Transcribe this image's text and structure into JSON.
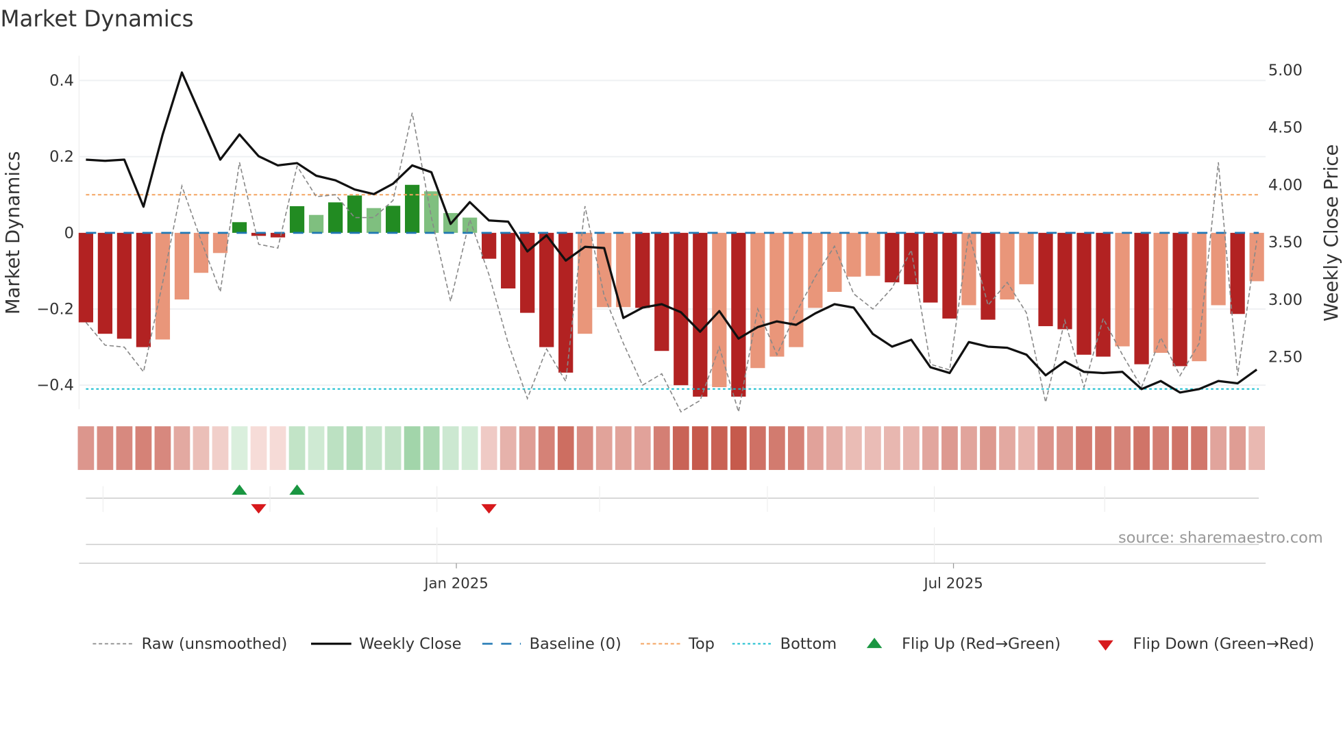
{
  "chart_data": {
    "type": "bar",
    "title": "Market Dynamics",
    "ylabel_left": "Market Dynamics",
    "ylabel_right": "Weekly Close Price",
    "ylim_left": [
      -0.47,
      0.47
    ],
    "ylim_right": [
      2.15,
      5.1
    ],
    "yticks_left": [
      {
        "v": 0.4,
        "label": "0.4"
      },
      {
        "v": 0.2,
        "label": "0.2"
      },
      {
        "v": 0,
        "label": "0"
      },
      {
        "v": -0.2,
        "label": "−0.2"
      },
      {
        "v": -0.4,
        "label": "−0.4"
      }
    ],
    "yticks_right": [
      {
        "v": 5.0,
        "label": "5.00"
      },
      {
        "v": 4.5,
        "label": "4.50"
      },
      {
        "v": 4.0,
        "label": "4.00"
      },
      {
        "v": 3.5,
        "label": "3.50"
      },
      {
        "v": 3.0,
        "label": "3.00"
      },
      {
        "v": 2.5,
        "label": "2.50"
      }
    ],
    "xticks": [
      {
        "index": 19.3,
        "label": "Jan 2025"
      },
      {
        "index": 45.2,
        "label": "Jul 2025"
      }
    ],
    "top_level": 0.1,
    "bottom_level": -0.41,
    "baseline": 0,
    "bars": [
      -0.235,
      -0.265,
      -0.278,
      -0.3,
      -0.28,
      -0.175,
      -0.105,
      -0.053,
      0.028,
      -0.008,
      -0.012,
      0.07,
      0.047,
      0.08,
      0.098,
      0.065,
      0.071,
      0.126,
      0.109,
      0.052,
      0.04,
      -0.068,
      -0.146,
      -0.21,
      -0.3,
      -0.367,
      -0.265,
      -0.195,
      -0.195,
      -0.197,
      -0.31,
      -0.4,
      -0.43,
      -0.405,
      -0.43,
      -0.355,
      -0.325,
      -0.3,
      -0.197,
      -0.155,
      -0.115,
      -0.113,
      -0.13,
      -0.135,
      -0.183,
      -0.225,
      -0.19,
      -0.228,
      -0.175,
      -0.135,
      -0.245,
      -0.253,
      -0.32,
      -0.325,
      -0.298,
      -0.345,
      -0.315,
      -0.35,
      -0.337,
      -0.19,
      -0.213,
      -0.127
    ],
    "bar_strong": [
      1,
      1,
      1,
      1,
      0,
      0,
      0,
      0,
      1,
      1,
      1,
      1,
      0,
      1,
      1,
      0,
      1,
      1,
      0,
      0,
      0,
      1,
      1,
      1,
      1,
      1,
      0,
      0,
      0,
      1,
      1,
      1,
      1,
      0,
      1,
      0,
      0,
      0,
      0,
      0,
      0,
      0,
      1,
      1,
      1,
      1,
      0,
      1,
      0,
      0,
      1,
      1,
      1,
      1,
      0,
      1,
      0,
      1,
      0,
      0,
      1,
      0
    ],
    "weekly_close": [
      4.22,
      4.21,
      4.22,
      3.81,
      4.44,
      4.98,
      4.6,
      4.22,
      4.44,
      4.25,
      4.17,
      4.19,
      4.08,
      4.04,
      3.96,
      3.92,
      4.01,
      4.17,
      4.11,
      3.66,
      3.85,
      3.69,
      3.68,
      3.42,
      3.56,
      3.34,
      3.46,
      3.45,
      2.84,
      2.93,
      2.96,
      2.89,
      2.72,
      2.9,
      2.66,
      2.76,
      2.81,
      2.78,
      2.88,
      2.96,
      2.93,
      2.7,
      2.59,
      2.65,
      2.41,
      2.36,
      2.63,
      2.59,
      2.58,
      2.52,
      2.34,
      2.46,
      2.37,
      2.36,
      2.37,
      2.22,
      2.29,
      2.19,
      2.22,
      2.29,
      2.27,
      2.39
    ],
    "raw": [
      -0.235,
      -0.295,
      -0.3,
      -0.365,
      -0.13,
      0.123,
      -0.02,
      -0.155,
      0.185,
      -0.03,
      -0.04,
      0.175,
      0.095,
      0.1,
      0.04,
      0.04,
      0.085,
      0.315,
      0.04,
      -0.18,
      0.035,
      -0.11,
      -0.29,
      -0.435,
      -0.305,
      -0.39,
      0.07,
      -0.165,
      -0.29,
      -0.4,
      -0.37,
      -0.47,
      -0.44,
      -0.3,
      -0.47,
      -0.2,
      -0.32,
      -0.21,
      -0.115,
      -0.035,
      -0.16,
      -0.2,
      -0.145,
      -0.045,
      -0.345,
      -0.36,
      0.0,
      -0.19,
      -0.13,
      -0.21,
      -0.445,
      -0.23,
      -0.405,
      -0.225,
      -0.32,
      -0.405,
      -0.275,
      -0.375,
      -0.29,
      0.185,
      -0.375,
      -0.02
    ],
    "flip_up": [
      8,
      11
    ],
    "flip_down": [
      9,
      21
    ],
    "legend": [
      "Raw (unsmoothed)",
      "Weekly Close",
      "Baseline (0)",
      "Top",
      "Bottom",
      "Flip Up (Red→Green)",
      "Flip Down (Green→Red)"
    ],
    "legend_placement": "bottom",
    "source": "source: sharemaestro.com"
  },
  "colors": {
    "red_strong": "#b22222",
    "red_light": "#e9967a",
    "green_strong": "#228b22",
    "green_light": "#7fbf7f",
    "close_line": "#111111",
    "raw_line": "#888888",
    "baseline": "#1f77b4",
    "top": "#f4a460",
    "bottom": "#17becf",
    "flip_up": "#1a9641",
    "flip_down": "#d7191c"
  }
}
